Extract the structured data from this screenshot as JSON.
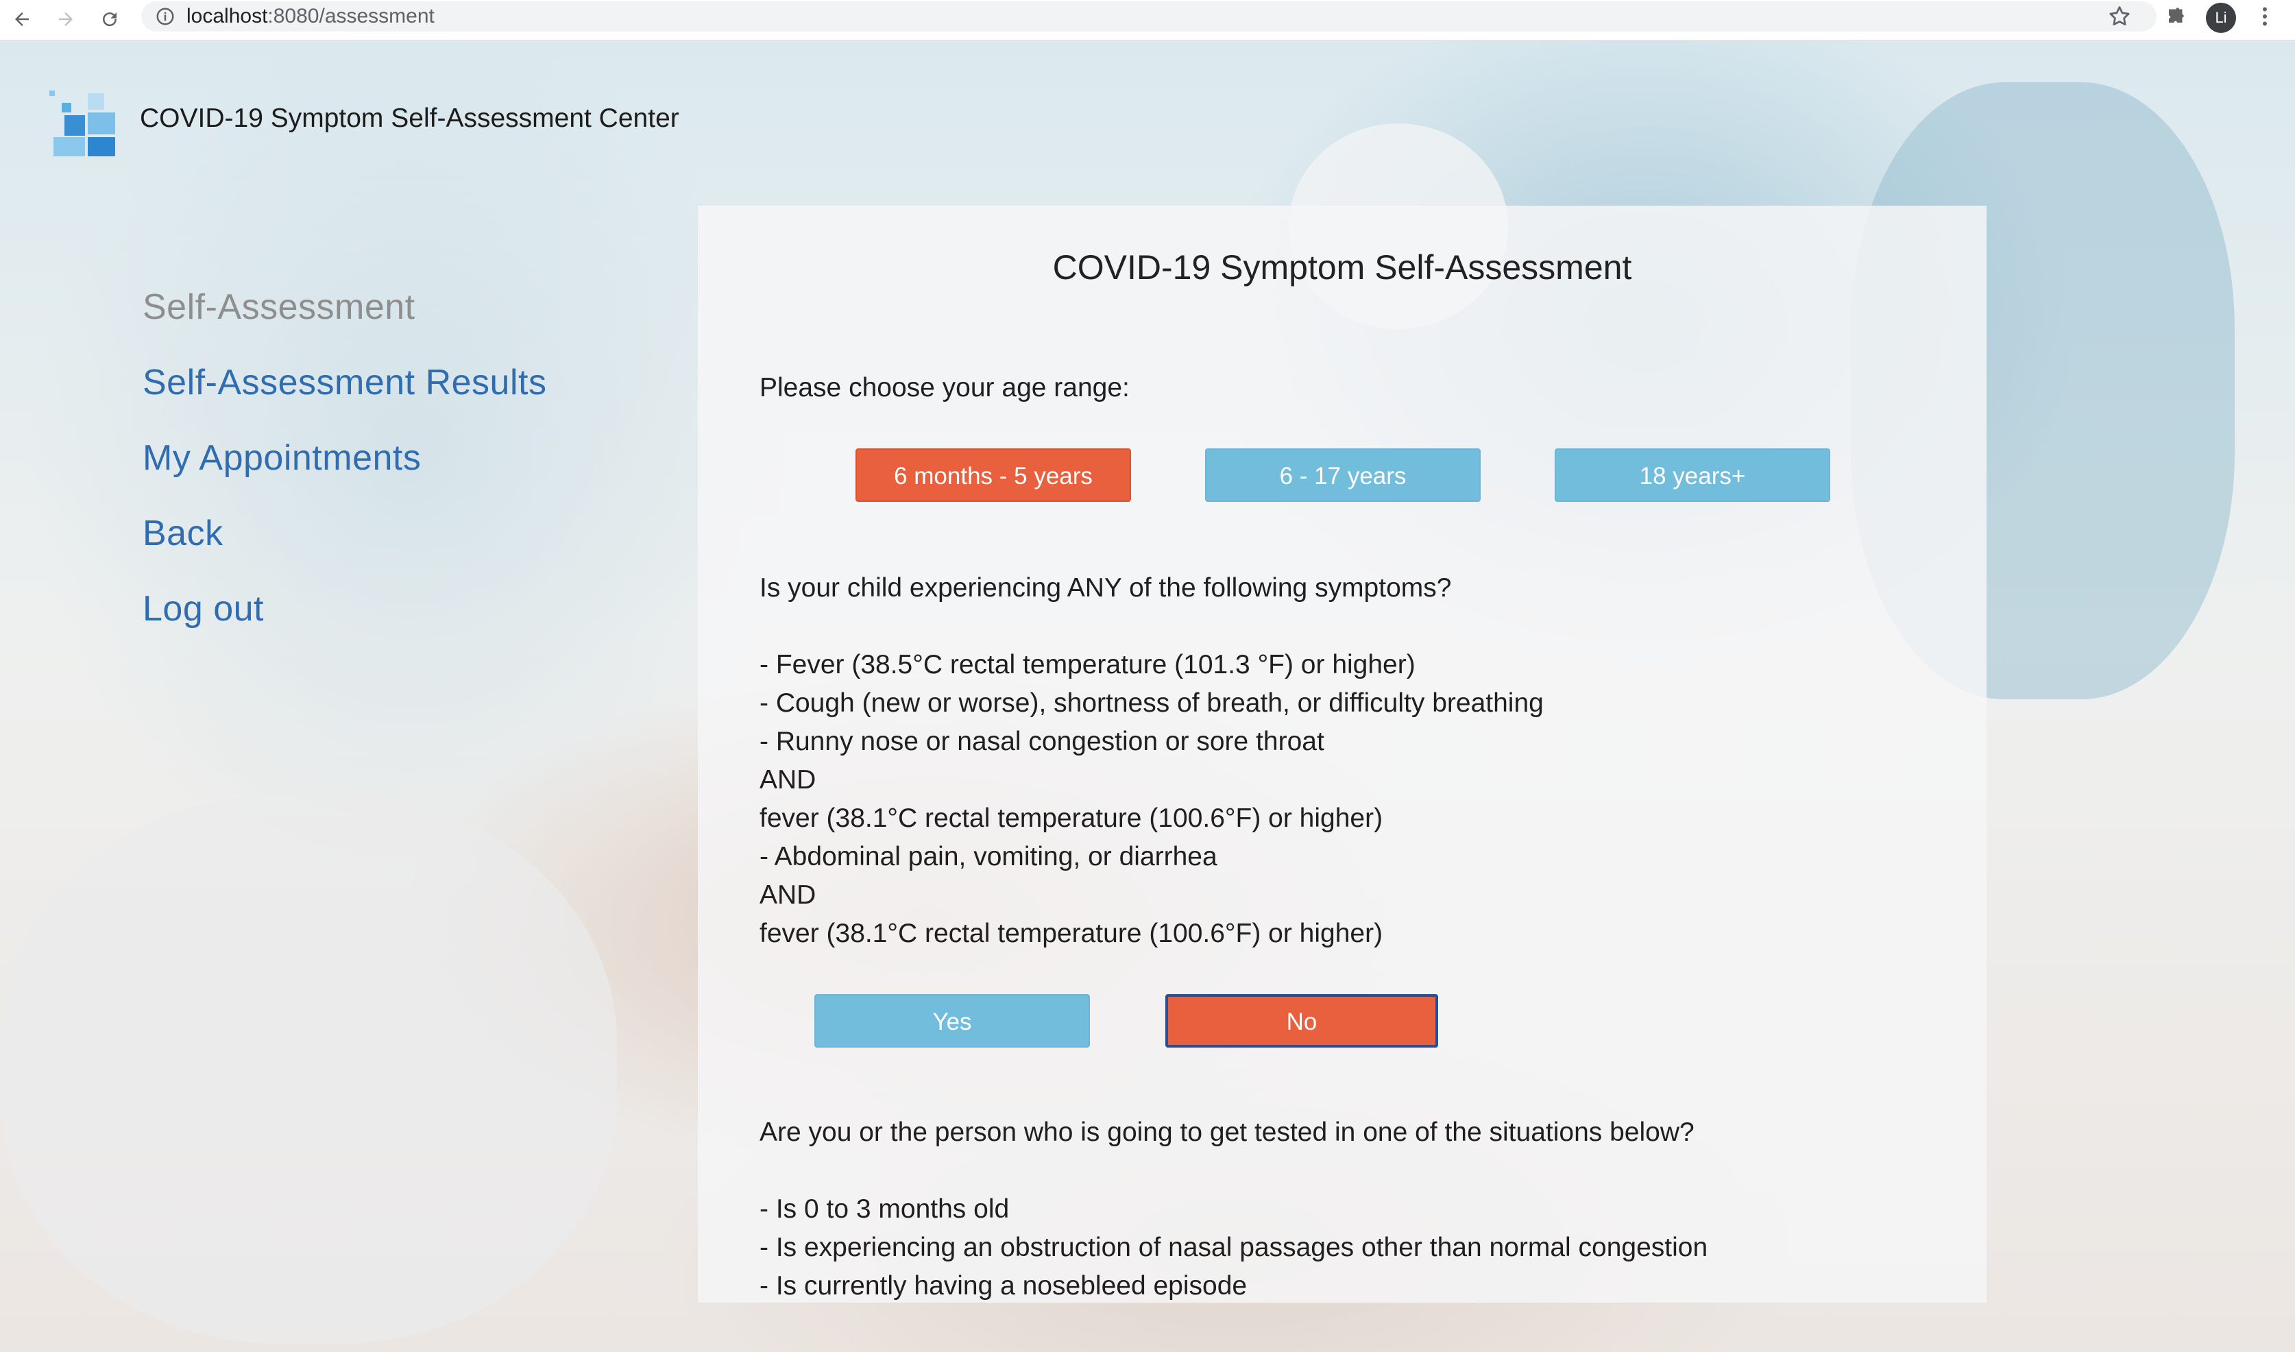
{
  "browser": {
    "url_host": "localhost",
    "url_path": ":8080/assessment",
    "profile_initial": "Li"
  },
  "header": {
    "app_title": "COVID-19 Symptom Self-Assessment Center"
  },
  "sidebar": {
    "items": [
      {
        "label": "Self-Assessment",
        "active": true
      },
      {
        "label": "Self-Assessment Results"
      },
      {
        "label": "My Appointments"
      },
      {
        "label": "Back"
      },
      {
        "label": "Log out"
      }
    ]
  },
  "assessment": {
    "title": "COVID-19 Symptom Self-Assessment",
    "age_question": "Please choose your age range:",
    "age_options": [
      {
        "label": "6 months - 5 years",
        "selected": true
      },
      {
        "label": "6 - 17 years",
        "selected": false
      },
      {
        "label": "18 years+",
        "selected": false
      }
    ],
    "symptom_question": "Is your child experiencing ANY of the following symptoms?",
    "symptom_lines": [
      "- Fever (38.5°C rectal temperature (101.3 °F) or higher)",
      "- Cough (new or worse), shortness of breath, or difficulty breathing",
      "- Runny nose or nasal congestion or sore throat",
      "AND",
      "fever (38.1°C rectal temperature (100.6°F) or higher)",
      "- Abdominal pain, vomiting, or diarrhea",
      "AND",
      "fever (38.1°C rectal temperature (100.6°F) or higher)"
    ],
    "yes_label": "Yes",
    "no_label": "No",
    "selected_answer": "No",
    "situation_question": "Are you or the person who is going to get tested in one of the situations below?",
    "situation_lines": [
      "- Is 0 to 3 months old",
      "- Is experiencing an obstruction of nasal passages other than normal congestion",
      "- Is currently having a nosebleed episode"
    ]
  },
  "colors": {
    "selected_button": "#e9603f",
    "unselected_button": "#72bcdc",
    "nav_link": "#2f6db0",
    "nav_active": "#8e8e8e"
  }
}
